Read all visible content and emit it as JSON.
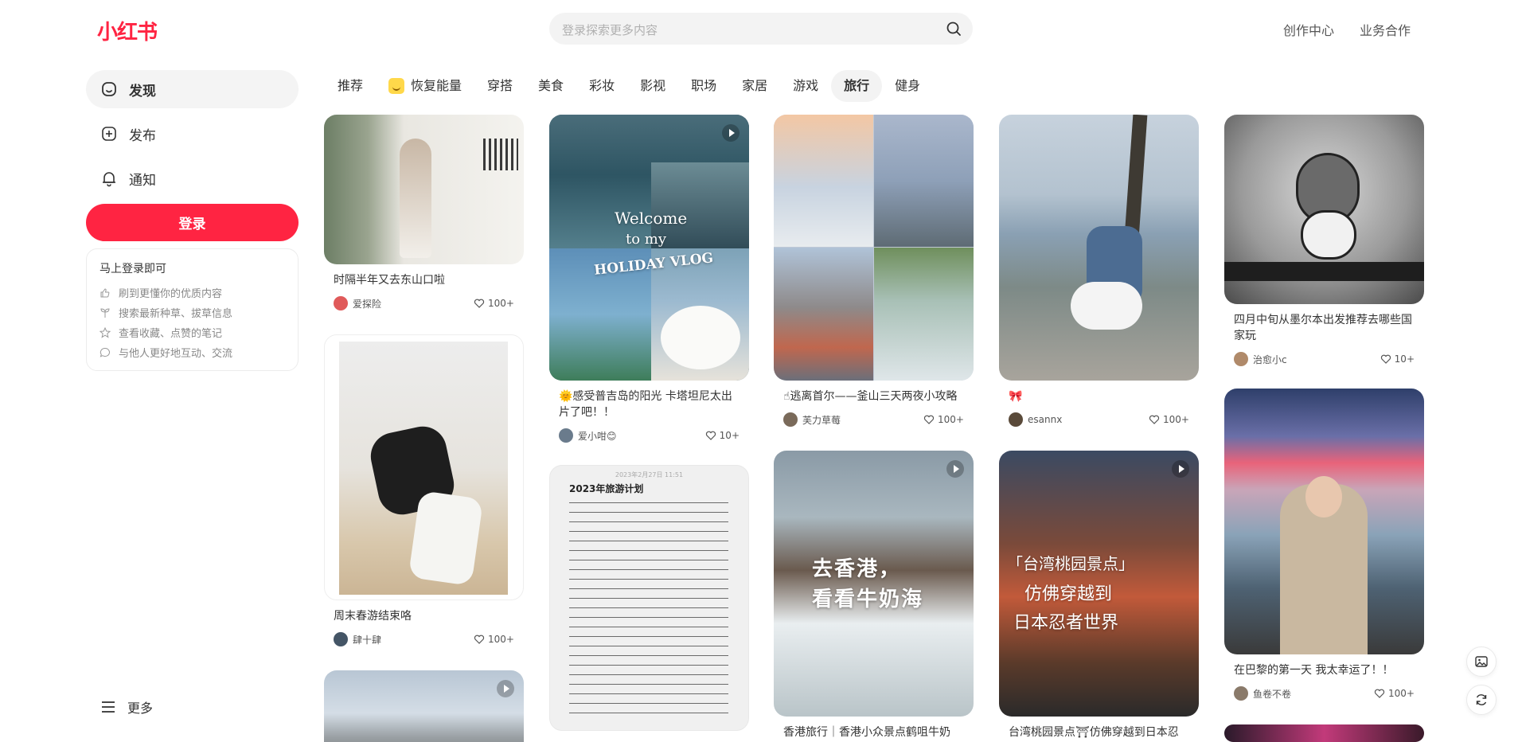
{
  "brand": {
    "logo": "小红书",
    "accent": "#ff2442"
  },
  "search": {
    "placeholder": "登录探索更多内容"
  },
  "header": {
    "links": [
      "创作中心",
      "业务合作"
    ]
  },
  "sidebar": {
    "items": [
      {
        "label": "发现",
        "icon": "home-icon"
      },
      {
        "label": "发布",
        "icon": "plus-square-icon"
      },
      {
        "label": "通知",
        "icon": "bell-icon"
      }
    ],
    "login_button": "登录",
    "login_card": {
      "title": "马上登录即可",
      "rows": [
        {
          "text": "刷到更懂你的优质内容",
          "icon": "thumb-up-icon"
        },
        {
          "text": "搜索最新种草、拔草信息",
          "icon": "sprout-icon"
        },
        {
          "text": "查看收藏、点赞的笔记",
          "icon": "star-icon"
        },
        {
          "text": "与他人更好地互动、交流",
          "icon": "chat-icon"
        }
      ]
    },
    "more_label": "更多"
  },
  "tabs": [
    "推荐",
    "恢复能量",
    "穿搭",
    "美食",
    "彩妆",
    "影视",
    "职场",
    "家居",
    "游戏",
    "旅行",
    "健身"
  ],
  "active_tab": "旅行",
  "cards": [
    {
      "title": "时隔半年又去东山口啦",
      "author": "爱探险",
      "likes": "100+"
    },
    {
      "title": "周末春游结束咯",
      "author": "肆十肆",
      "likes": "100+"
    },
    {
      "title": "🌞感受普吉岛的阳光 卡塔坦尼太出片了吧！！",
      "author": "爱小咁😊",
      "likes": "10+",
      "overlay": [
        "Welcome",
        "to my",
        "HOLIDAY VLOG"
      ]
    },
    {
      "title": "",
      "overlay": [
        "2023年2月27日 11:51",
        "2023年旅游计划"
      ]
    },
    {
      "title": "☝逃离首尔——釜山三天两夜小攻略",
      "author": "芙力草莓",
      "likes": "100+"
    },
    {
      "title": "香港旅行｜香港小众景点鹤咀牛奶",
      "overlay": [
        "去香港，",
        "看看牛奶海"
      ]
    },
    {
      "title": "🎀",
      "author": "esannx",
      "likes": "100+"
    },
    {
      "title": "台湾桃园景点⛩仿佛穿越到日本忍",
      "overlay": [
        "「台湾桃园景点」",
        "仿佛穿越到",
        "日本忍者世界"
      ]
    },
    {
      "title": "四月中旬从墨尔本出发推荐去哪些国家玩",
      "author": "治愈小c",
      "likes": "10+"
    },
    {
      "title": "在巴黎的第一天 我太幸运了！！",
      "author": "鱼卷不卷",
      "likes": "100+"
    }
  ]
}
